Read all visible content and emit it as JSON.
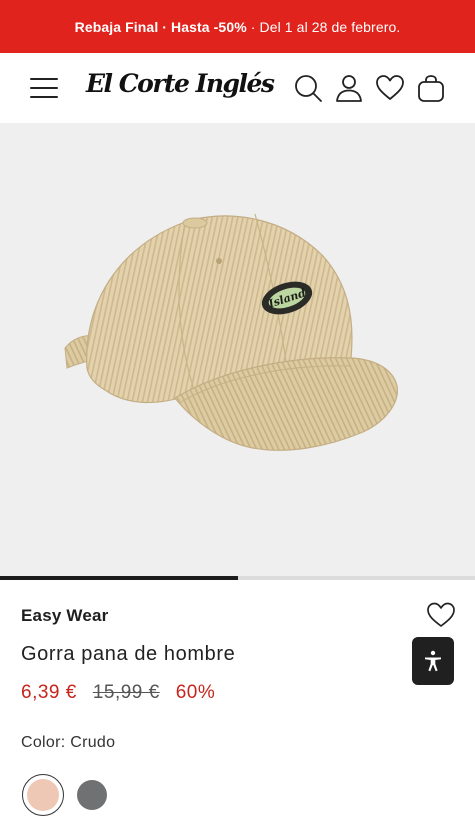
{
  "promo": {
    "bold_text": "Rebaja Final · Hasta -50%",
    "rest_text": " · Del 1 al 28 de febrero."
  },
  "header": {
    "logo_text": "El Corte Inglés",
    "icons": [
      "menu-icon",
      "search-icon",
      "user-icon",
      "heart-icon",
      "bag-icon"
    ]
  },
  "gallery": {
    "image_description_icon": "cap-image",
    "badge_text": "Island",
    "progress_fraction": 0.5
  },
  "product": {
    "brand": "Easy Wear",
    "name": "Gorra pana de hombre",
    "price_now": "6,39 €",
    "price_old": "15,99 €",
    "discount": "60%",
    "color_label": "Color: Crudo"
  },
  "colors": {
    "accent_red": "#e0231c",
    "price_red": "#c8241c",
    "swatch_selected": "#eec7b5",
    "swatch_other": "#6f7172"
  }
}
